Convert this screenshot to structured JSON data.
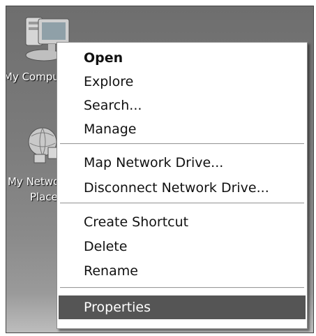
{
  "desktop": {
    "icons": [
      {
        "label": "My Computer",
        "icon": "my-computer-icon"
      },
      {
        "label": "My Network",
        "label2": "Places",
        "icon": "my-network-places-icon"
      }
    ]
  },
  "context_menu": {
    "items": [
      {
        "label": "Open",
        "bold": true
      },
      {
        "label": "Explore"
      },
      {
        "label": "Search..."
      },
      {
        "label": "Manage"
      },
      {
        "label": "Map Network Drive..."
      },
      {
        "label": "Disconnect Network Drive..."
      },
      {
        "label": "Create Shortcut"
      },
      {
        "label": "Delete"
      },
      {
        "label": "Rename"
      },
      {
        "label": "Properties",
        "highlighted": true
      }
    ]
  },
  "colors": {
    "highlight": "#555555",
    "menu_background": "#ffffff"
  }
}
